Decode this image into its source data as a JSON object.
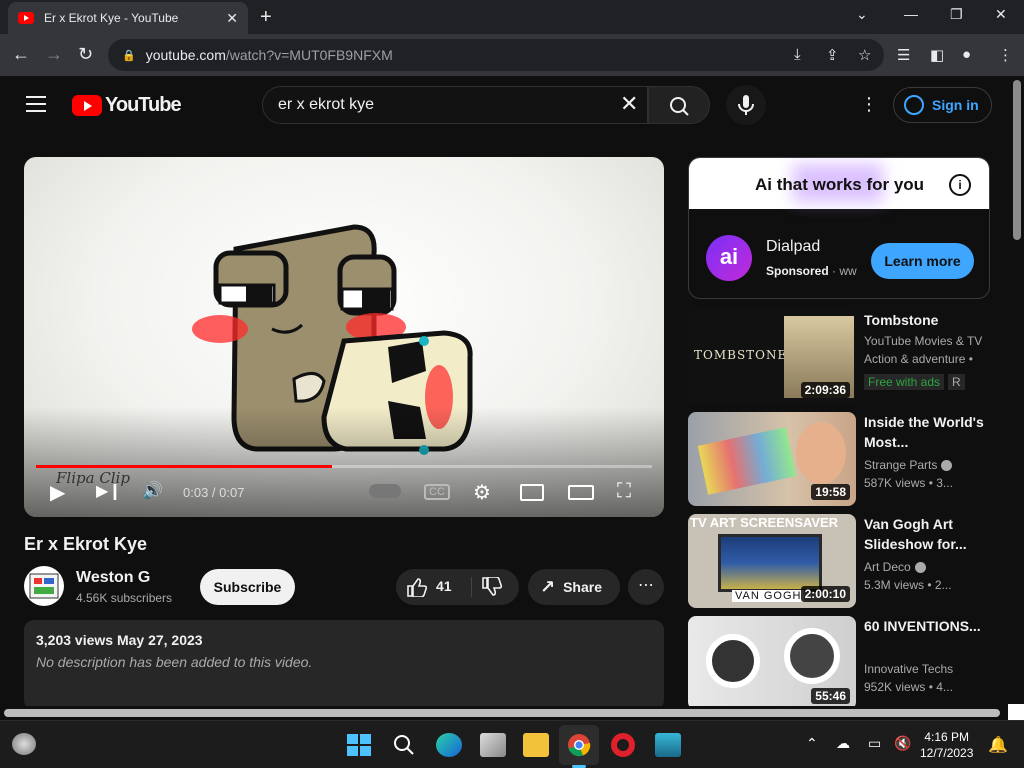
{
  "browser": {
    "tab_title": "Er x Ekrot Kye - YouTube",
    "url_domain": "youtube.com",
    "url_path": "/watch?v=MUT0FB9NFXM"
  },
  "header": {
    "logo_text": "YouTube",
    "search_value": "er x ekrot kye",
    "signin_label": "Sign in"
  },
  "player": {
    "time": "0:03 / 0:07",
    "progress": 0.48,
    "watermark": "Flipa Clip"
  },
  "video": {
    "title": "Er x Ekrot Kye",
    "channel": "Weston G",
    "subscribers": "4.56K subscribers",
    "subscribe_label": "Subscribe",
    "likes": "41",
    "share_label": "Share",
    "views_date": "3,203 views  May 27, 2023",
    "description": "No description has been added to this video."
  },
  "ad": {
    "headline": "Ai that works for you",
    "advertiser": "Dialpad",
    "logo_text": "ai",
    "sponsored": "Sponsored",
    "sponsored_extra": " · ww",
    "cta": "Learn more"
  },
  "related": [
    {
      "title": "Tombstone",
      "channel": "YouTube Movies & TV",
      "line2": "Action & adventure •",
      "free_badge": "Free with ads",
      "rating": "R",
      "duration": "2:09:36",
      "thumb_text": "TOMBSTONE"
    },
    {
      "title": "Inside the World's Most...",
      "channel": "Strange Parts",
      "meta": "587K views  • 3...",
      "duration": "19:58"
    },
    {
      "title": "Van Gogh Art Slideshow for...",
      "channel": "Art Deco",
      "meta": "5.3M views  • 2...",
      "duration": "2:00:10",
      "thumb_text": "TV ART SCREENSAVER",
      "thumb_sub": "VAN GOGH"
    },
    {
      "title": "60 INVENTIONS...",
      "channel": "Innovative Techs",
      "meta": "952K views  • 4...",
      "duration": "55:46"
    }
  ],
  "taskbar": {
    "time": "4:16 PM",
    "date": "12/7/2023"
  },
  "colors": {
    "accent_red": "#ff0000",
    "link_blue": "#3ea6ff",
    "free_green": "#2ba640"
  }
}
